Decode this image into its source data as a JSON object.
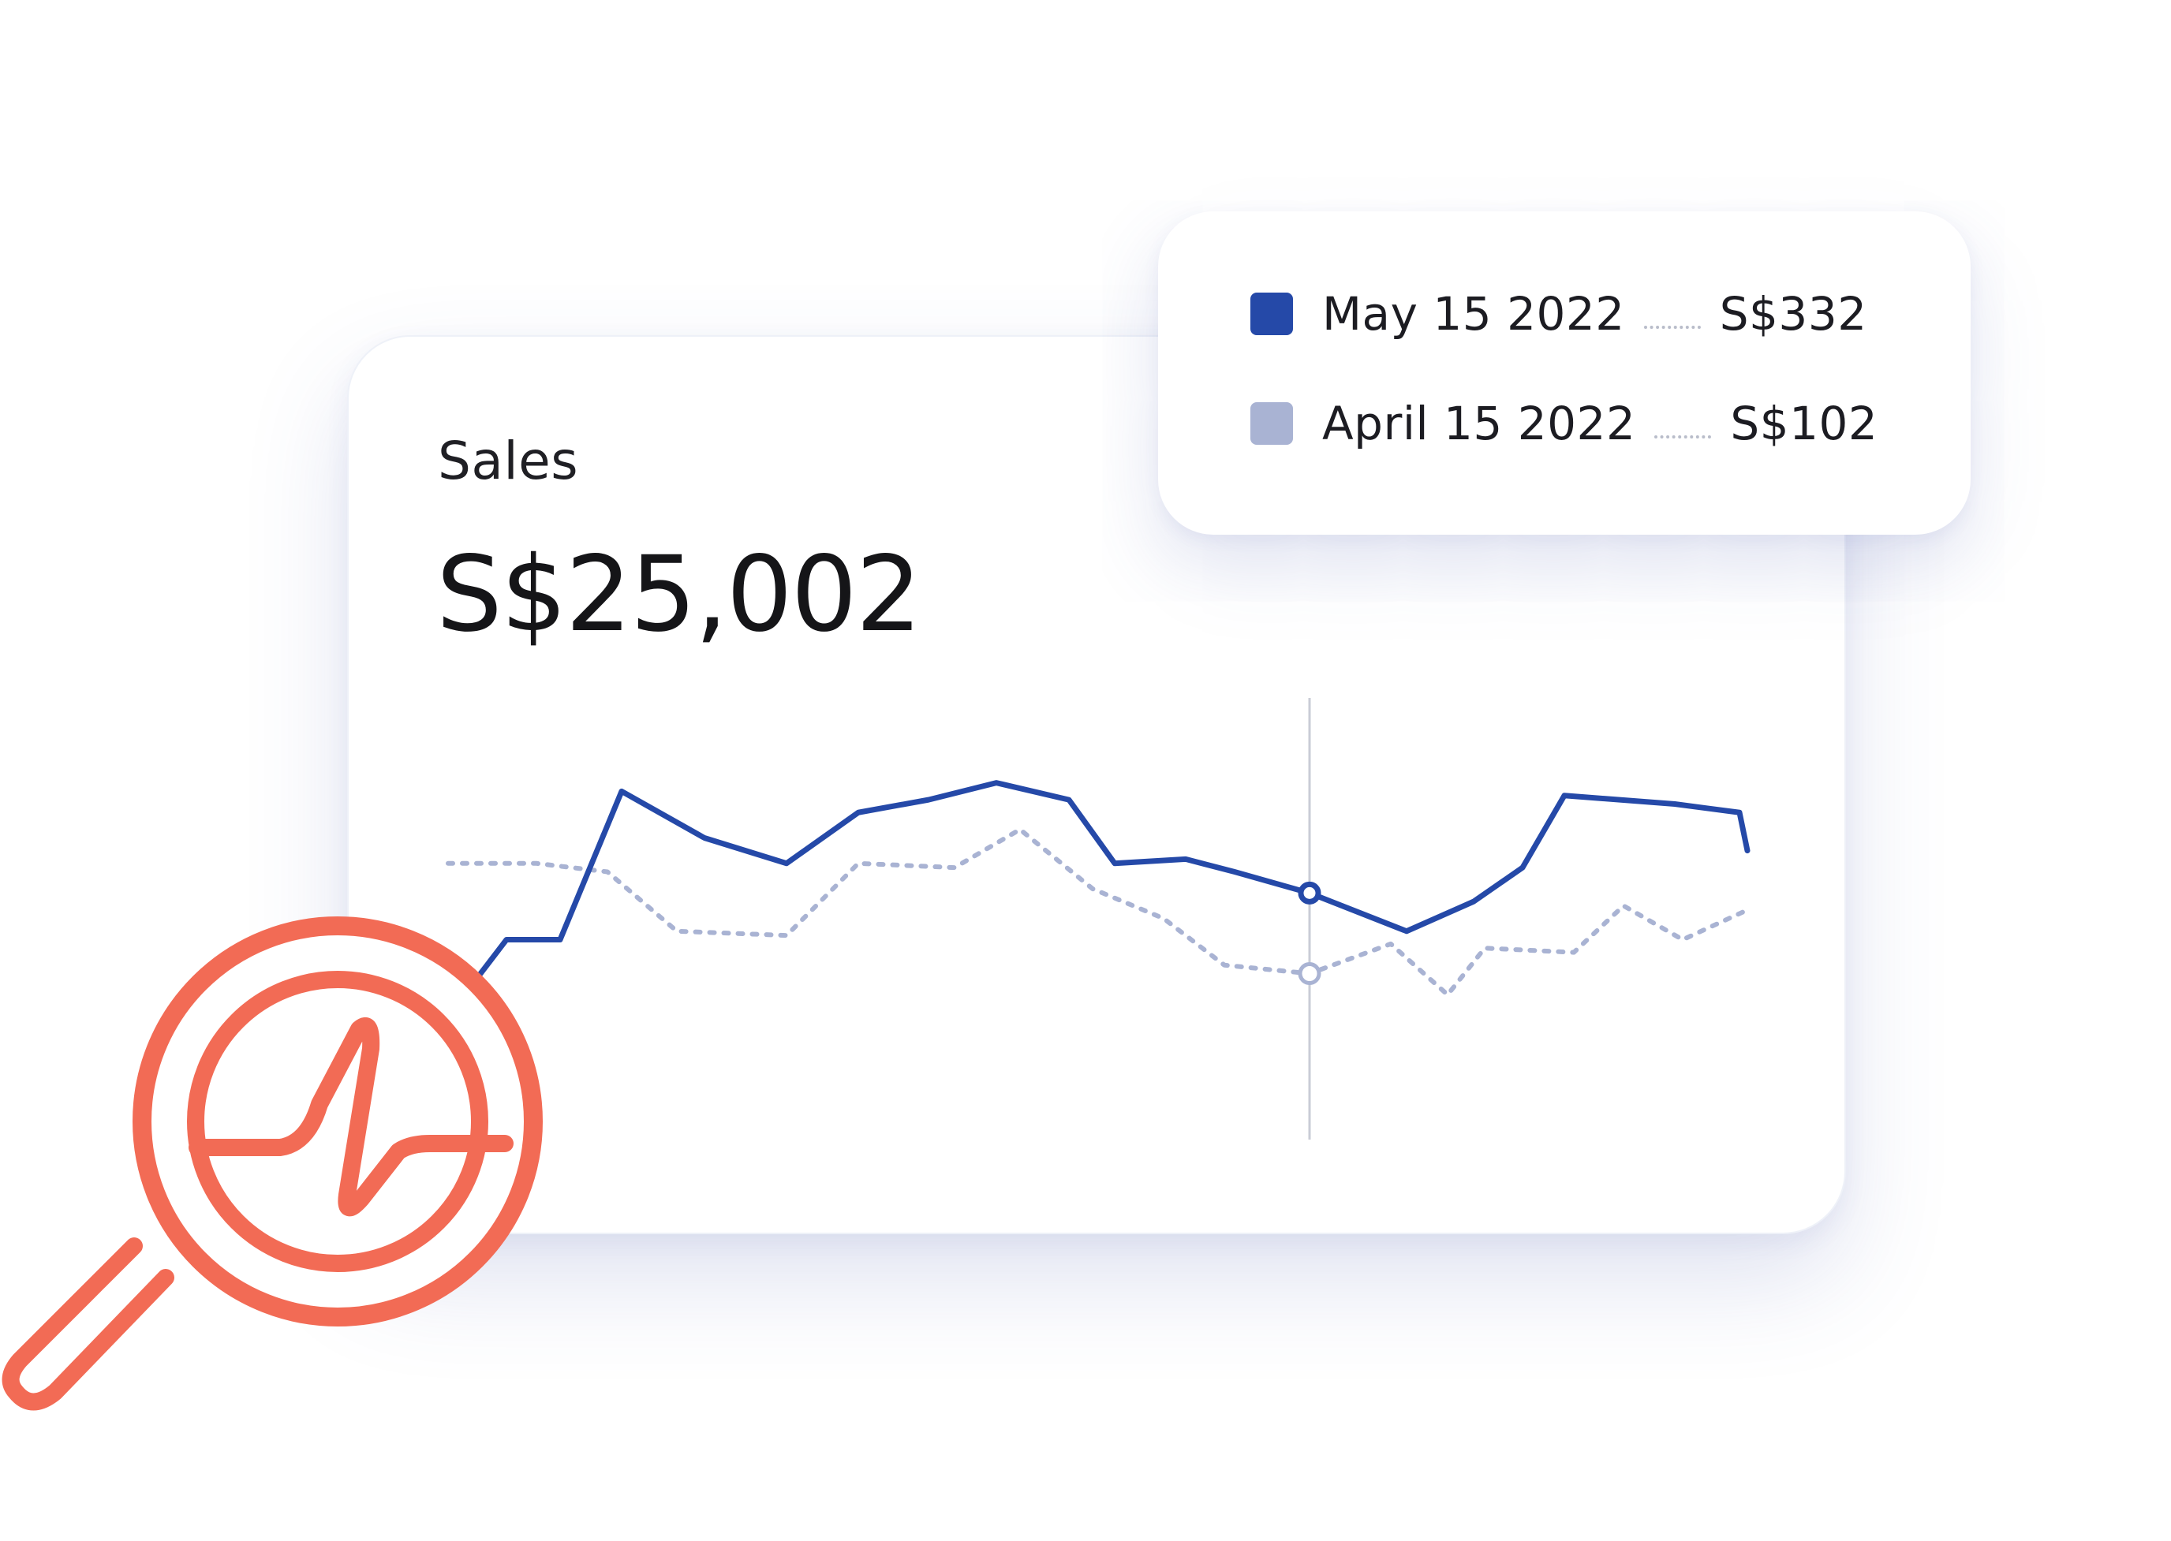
{
  "card": {
    "title": "Sales",
    "total": "S$25,002"
  },
  "tooltip": {
    "rows": [
      {
        "date": "May 15 2022",
        "value": "S$332",
        "color": "#2549a8"
      },
      {
        "date": "April 15 2022",
        "value": "S$102",
        "color": "#a9b3d3"
      }
    ]
  },
  "chart_data": {
    "type": "line",
    "x": [
      0,
      1,
      2,
      3,
      4,
      5,
      6,
      7,
      8,
      9,
      10,
      11,
      12,
      13,
      14,
      15,
      16,
      17,
      18,
      19,
      20,
      21
    ],
    "series": [
      {
        "name": "May 15 2022",
        "style": "solid",
        "color": "#2549a8",
        "values": [
          18,
          36,
          36,
          71,
          60,
          54,
          66,
          69,
          73,
          69,
          54,
          55,
          52,
          47,
          38,
          45,
          53,
          70,
          68,
          66,
          57
        ]
      },
      {
        "name": "April 15 2022",
        "style": "dotted",
        "color": "#a9b3d3",
        "values": [
          54,
          54,
          52,
          38,
          37,
          54,
          53,
          62,
          48,
          41,
          30,
          28,
          35,
          23,
          34,
          33,
          44,
          36,
          43
        ]
      }
    ],
    "highlight_index": {
      "May 15 2022": 13,
      "April 15 2022": 11
    },
    "crosshair": true,
    "axes_visible": false,
    "grid": false
  },
  "decoration": {
    "magnifier_icon": "magnifier-heartbeat-icon",
    "magnifier_color": "#f26b55"
  }
}
